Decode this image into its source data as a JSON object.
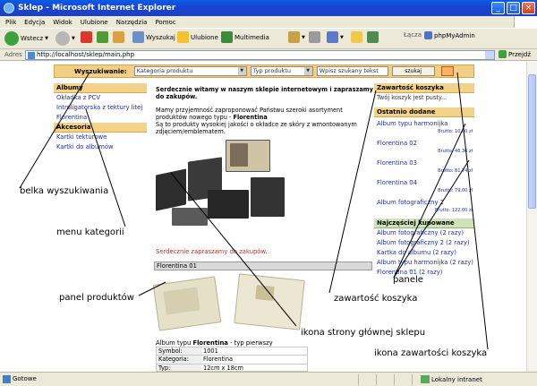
{
  "window": {
    "title": "Sklep - Microsoft Internet Explorer",
    "min": "_",
    "max": "□",
    "close": "×"
  },
  "menu": [
    "Plik",
    "Edycja",
    "Widok",
    "Ulubione",
    "Narzędzia",
    "Pomoc"
  ],
  "toolbar": {
    "back": "Wstecz",
    "search": "Wyszukaj",
    "favorites": "Ulubione",
    "multimedia": "Multimedia",
    "links": "Łącza",
    "phpmyadmin": "phpMyAdmin"
  },
  "address": {
    "label": "Adres",
    "url": "http://localhost/sklep/main.php",
    "go": "Przejdź"
  },
  "search": {
    "label": "Wyszukiwanie:",
    "category": "Kategoria produktu",
    "type": "Typ produktu",
    "placeholder": "Wpisz szukany tekst",
    "button": "szukaj"
  },
  "categories": {
    "group1": "Albumy",
    "group1_items": [
      "Okładka z PCV",
      "Introligatorska z tektury litej",
      "Florentina"
    ],
    "group2": "Akcesoria",
    "group2_items": [
      "Kartki tekturowe",
      "Kartki do albumów"
    ]
  },
  "welcome": {
    "title": "Serdecznie witamy w naszym sklepie internetowym i zapraszamy do zakupów.",
    "p1": "Mamy przyjemność zaproponować Państwu szeroki asortyment produktów nowego typu -",
    "p1_bold": "Florentina",
    "p2": "Są to produkty wysokiej jakości o okładce ze skóry z wmontowanym zdjęciem/emblematem.",
    "invite": "Serdecznie zapraszamy do zakupów.",
    "product_bar": "Florentina 01",
    "caption_prefix": "Album typu",
    "caption_bold": "Florentina",
    "caption_suffix": "- typ pierwszy",
    "details": [
      {
        "k": "Symbol:",
        "v": "1001"
      },
      {
        "k": "Kategoria:",
        "v": "Florentina"
      },
      {
        "k": "Typ:",
        "v": "12cm x 18cm"
      }
    ]
  },
  "cart": {
    "title": "Zawartość koszyka",
    "empty": "Twój koszyk jest pusty..."
  },
  "recent": {
    "title": "Ostatnio dodane",
    "items": [
      {
        "name": "Album typu harmonijka",
        "price": "Brutto: 10.00 zł"
      },
      {
        "name": "Florentina 02",
        "price": "Brutto: 46.36 zł"
      },
      {
        "name": "Florentina 03",
        "price": "Brutto: 81.74 zł"
      },
      {
        "name": "Florentina 04",
        "price": "Brutto: 79.00 zł"
      },
      {
        "name": "Album fotograficzny 2",
        "price": "Brutto: 122.00 zł"
      }
    ]
  },
  "bestsellers": {
    "title": "Najczęściej kupowane",
    "items": [
      "Album fotograficzny (2 razy)",
      "Album fotograficzny 2 (2 razy)",
      "Kartka do albumu (2 razy)",
      "Album typu harmonijka (2 razy)",
      "Florentina 01 (2 razy)"
    ]
  },
  "annotations": {
    "search_bar": "belka wyszukiwania",
    "category_menu": "menu kategorii",
    "product_panel": "panel produktów",
    "home_icon": "ikona strony głównej sklepu",
    "panels": "panele",
    "cart_content": "zawartość koszyka",
    "cart_icon": "ikona zawartości koszyka"
  },
  "status": {
    "text": "Gotowe",
    "zone": "Lokalny intranet"
  }
}
